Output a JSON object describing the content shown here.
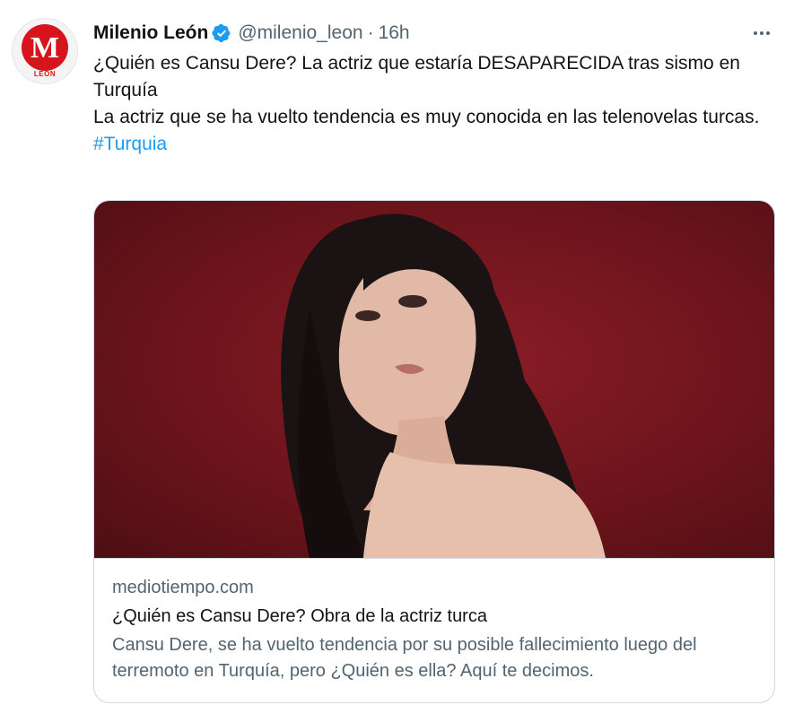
{
  "tweet": {
    "author_name": "Milenio León",
    "handle": "@milenio_leon",
    "separator": "·",
    "time": "16h",
    "avatar": {
      "logo_letter": "M",
      "logo_subtitle": "LEÓN"
    },
    "text_line1": "¿Quién es Cansu Dere? La actriz que estaría DESAPARECIDA tras sismo en Turquía",
    "text_line2": "La actriz que se ha vuelto tendencia es muy conocida en las telenovelas turcas.",
    "hashtag": "#Turquia"
  },
  "card": {
    "domain": "mediotiempo.com",
    "title": "¿Quién es Cansu Dere? Obra de la actriz turca",
    "description": "Cansu Dere, se ha vuelto tendencia por su posible fallecimiento luego del terremoto en Turquía, pero ¿Quién es ella? Aquí te decimos."
  },
  "colors": {
    "accent": "#1d9bf0",
    "secondary_text": "#536471",
    "brand_red": "#d7141c",
    "image_background": "#6d141c"
  },
  "icons": [
    "verified-badge-icon",
    "more-options-icon"
  ]
}
